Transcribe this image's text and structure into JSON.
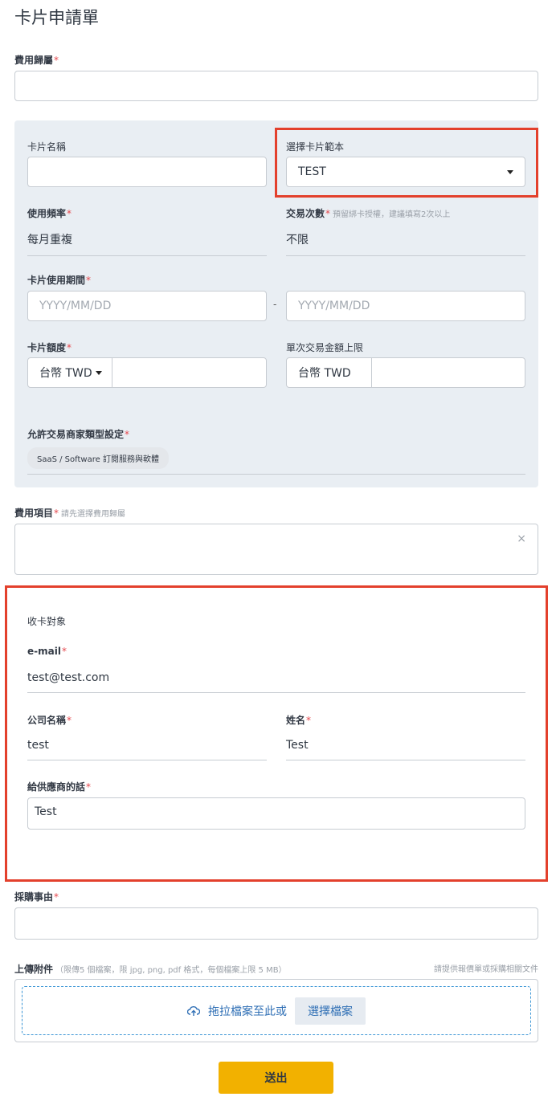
{
  "page": {
    "title": "卡片申請單"
  },
  "expense_category": {
    "label": "費用歸屬",
    "value": ""
  },
  "card_section": {
    "card_name": {
      "label": "卡片名稱",
      "value": ""
    },
    "template": {
      "label": "選擇卡片範本",
      "value": "TEST"
    },
    "frequency": {
      "label": "使用頻率",
      "value": "每月重複"
    },
    "transactions": {
      "label": "交易次數",
      "hint": "預留綁卡授權，建議填寫2次以上",
      "value": "不限"
    },
    "period": {
      "label": "卡片使用期間",
      "start_placeholder": "YYYY/MM/DD",
      "end_placeholder": "YYYY/MM/DD",
      "separator": "-"
    },
    "limit": {
      "label": "卡片額度",
      "currency": "台幣 TWD",
      "value": ""
    },
    "single_limit": {
      "label": "單次交易金額上限",
      "currency": "台幣 TWD",
      "value": ""
    },
    "merchant_types": {
      "label": "允許交易商家類型設定",
      "chip": "SaaS / Software 訂閱服務與軟體"
    }
  },
  "expense_item": {
    "label": "費用項目",
    "hint": "請先選擇費用歸屬",
    "clear": "×"
  },
  "recipient": {
    "heading": "收卡對象",
    "email": {
      "label": "e-mail",
      "value": "test@test.com"
    },
    "company": {
      "label": "公司名稱",
      "value": "test"
    },
    "name": {
      "label": "姓名",
      "value": "Test"
    },
    "message": {
      "label": "給供應商的話",
      "value": "Test"
    }
  },
  "purchase_reason": {
    "label": "採購事由",
    "value": ""
  },
  "attachments": {
    "label": "上傳附件",
    "hint": "（限傳5 個檔案，限 jpg, png, pdf 格式，每個檔案上限 5 MB）",
    "right_hint": "請提供報價單或採購相關文件",
    "drop_text": "拖拉檔案至此或",
    "choose_label": "選擇檔案"
  },
  "submit_label": "送出",
  "colors": {
    "accent_red": "#e3402c",
    "submit_yellow": "#f2b100",
    "link_blue": "#2f6fb5",
    "panel_gray": "#e9eef3"
  }
}
